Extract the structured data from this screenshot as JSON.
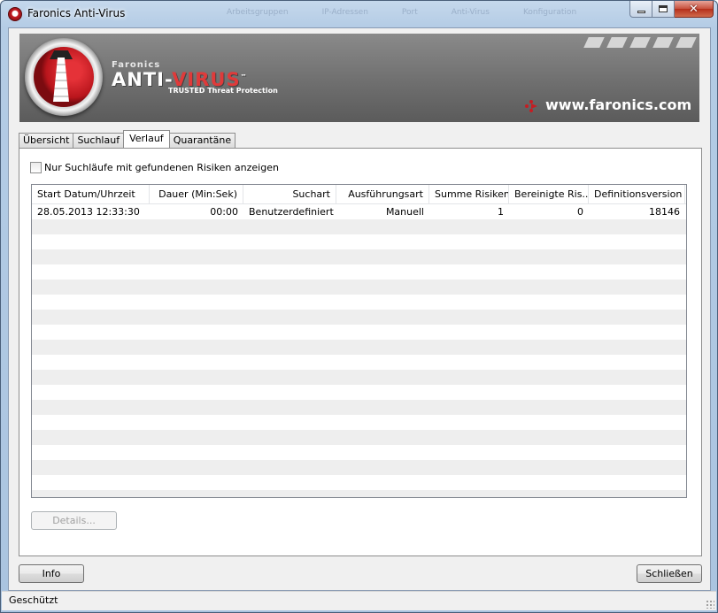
{
  "window": {
    "title": "Faronics Anti-Virus",
    "ghost_menu": [
      "Arbeitsgruppen",
      "IP-Adressen",
      "Port",
      "Anti-Virus",
      "Konfiguration"
    ],
    "close_glyph": "✕"
  },
  "banner": {
    "brand_small": "Faronics",
    "product_anti": "ANTI-",
    "product_virus": "VIRUS",
    "tm": "™",
    "tagline": "TRUSTED Threat Protection",
    "website": "www.faronics.com",
    "accent_color": "#c51d23"
  },
  "tabs": [
    {
      "label": "Übersicht",
      "active": false
    },
    {
      "label": "Suchlauf",
      "active": false
    },
    {
      "label": "Verlauf",
      "active": true
    },
    {
      "label": "Quarantäne",
      "active": false
    }
  ],
  "filter": {
    "checked": false,
    "label": "Nur Suchläufe mit gefundenen Risiken anzeigen"
  },
  "table": {
    "columns": [
      "Start Datum/Uhrzeit",
      "Dauer (Min:Sek)",
      "Suchart",
      "Ausführungsart",
      "Summe Risiken",
      "Bereinigte Ris...",
      "Definitionsversion"
    ],
    "rows": [
      [
        "28.05.2013 12:33:30",
        "00:00",
        "Benutzerdefiniert",
        "Manuell",
        "1",
        "0",
        "18146"
      ]
    ]
  },
  "buttons": {
    "details": "Details...",
    "info": "Info",
    "close": "Schließen"
  },
  "status": {
    "text": "Geschützt"
  }
}
